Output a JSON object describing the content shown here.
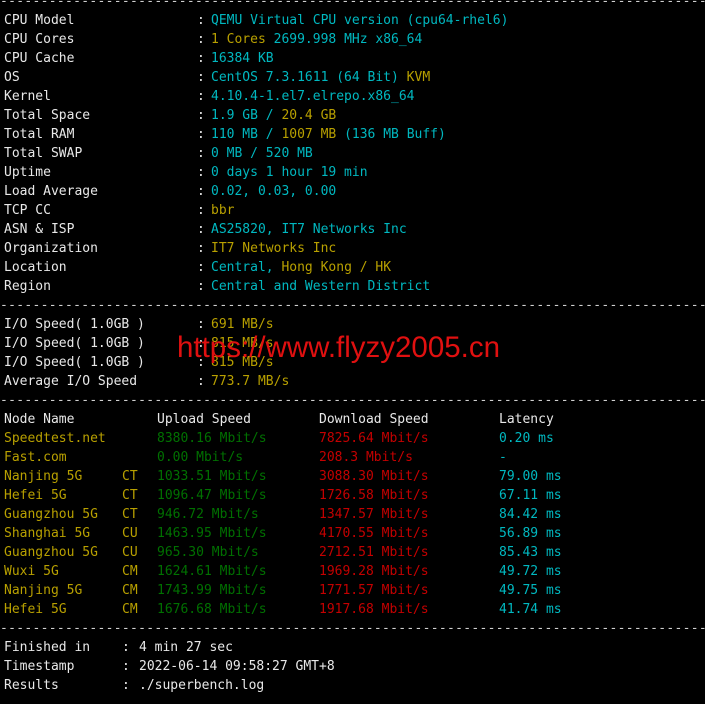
{
  "colors": {
    "white": "#e8e8e8",
    "cyan": "#00b8c0",
    "yellow": "#b8a000",
    "green": "#007000",
    "red": "#c40000",
    "watermark": "#e01010"
  },
  "separator": "------------------------------------------------------------------------------------------",
  "system_info": [
    {
      "label": "CPU Model",
      "value": [
        {
          "t": "QEMU Virtual CPU version (cpu64-rhel6)",
          "c": "cyan"
        }
      ]
    },
    {
      "label": "CPU Cores",
      "value": [
        {
          "t": "1 Cores ",
          "c": "yellow"
        },
        {
          "t": "2699.998 MHz x86_64",
          "c": "cyan"
        }
      ]
    },
    {
      "label": "CPU Cache",
      "value": [
        {
          "t": "16384 KB",
          "c": "cyan"
        }
      ]
    },
    {
      "label": "OS",
      "value": [
        {
          "t": "CentOS 7.3.1611 (64 Bit) ",
          "c": "cyan"
        },
        {
          "t": "KVM",
          "c": "yellow"
        }
      ]
    },
    {
      "label": "Kernel",
      "value": [
        {
          "t": "4.10.4-1.el7.elrepo.x86_64",
          "c": "cyan"
        }
      ]
    },
    {
      "label": "Total Space",
      "value": [
        {
          "t": "1.9 GB / ",
          "c": "cyan"
        },
        {
          "t": "20.4 GB",
          "c": "yellow"
        }
      ]
    },
    {
      "label": "Total RAM",
      "value": [
        {
          "t": "110 MB / ",
          "c": "cyan"
        },
        {
          "t": "1007 MB",
          "c": "yellow"
        },
        {
          "t": " (136 MB Buff)",
          "c": "cyan"
        }
      ]
    },
    {
      "label": "Total SWAP",
      "value": [
        {
          "t": "0 MB / 520 MB",
          "c": "cyan"
        }
      ]
    },
    {
      "label": "Uptime",
      "value": [
        {
          "t": "0 days 1 hour 19 min",
          "c": "cyan"
        }
      ]
    },
    {
      "label": "Load Average",
      "value": [
        {
          "t": "0.02, 0.03, 0.00",
          "c": "cyan"
        }
      ]
    },
    {
      "label": "TCP CC",
      "value": [
        {
          "t": "bbr",
          "c": "yellow"
        }
      ]
    },
    {
      "label": "ASN & ISP",
      "value": [
        {
          "t": "AS25820, IT7 Networks Inc",
          "c": "cyan"
        }
      ]
    },
    {
      "label": "Organization",
      "value": [
        {
          "t": "IT7 Networks Inc",
          "c": "yellow"
        }
      ]
    },
    {
      "label": "Location",
      "value": [
        {
          "t": "Central, ",
          "c": "cyan"
        },
        {
          "t": "Hong Kong / HK",
          "c": "yellow"
        }
      ]
    },
    {
      "label": "Region",
      "value": [
        {
          "t": "Central and Western District",
          "c": "cyan"
        }
      ]
    }
  ],
  "io": [
    {
      "label": "I/O Speed( 1.0GB )",
      "value": [
        {
          "t": "691 MB/s",
          "c": "yellow"
        }
      ]
    },
    {
      "label": "I/O Speed( 1.0GB )",
      "value": [
        {
          "t": "815 MB/s",
          "c": "yellow"
        }
      ]
    },
    {
      "label": "I/O Speed( 1.0GB )",
      "value": [
        {
          "t": "815 MB/s",
          "c": "yellow"
        }
      ]
    },
    {
      "label": "Average I/O Speed",
      "value": [
        {
          "t": "773.7 MB/s",
          "c": "yellow"
        }
      ]
    }
  ],
  "speedtest": {
    "headers": [
      "Node Name",
      "Upload Speed",
      "Download Speed",
      "Latency"
    ],
    "rows": [
      {
        "node": "Speedtest.net",
        "isp": "",
        "up": "8380.16 Mbit/s",
        "down": "7825.64 Mbit/s",
        "lat": "0.20 ms"
      },
      {
        "node": "Fast.com",
        "isp": "",
        "up": "0.00 Mbit/s",
        "down": "208.3 Mbit/s",
        "lat": "-"
      },
      {
        "node": "Nanjing 5G",
        "isp": "CT",
        "up": "1033.51 Mbit/s",
        "down": "3088.30 Mbit/s",
        "lat": "79.00 ms"
      },
      {
        "node": "Hefei 5G",
        "isp": "CT",
        "up": "1096.47 Mbit/s",
        "down": "1726.58 Mbit/s",
        "lat": "67.11 ms"
      },
      {
        "node": "Guangzhou 5G",
        "isp": "CT",
        "up": "946.72 Mbit/s",
        "down": "1347.57 Mbit/s",
        "lat": "84.42 ms"
      },
      {
        "node": "Shanghai 5G",
        "isp": "CU",
        "up": "1463.95 Mbit/s",
        "down": "4170.55 Mbit/s",
        "lat": "56.89 ms"
      },
      {
        "node": "Guangzhou 5G",
        "isp": "CU",
        "up": "965.30 Mbit/s",
        "down": "2712.51 Mbit/s",
        "lat": "85.43 ms"
      },
      {
        "node": "Wuxi 5G",
        "isp": "CM",
        "up": "1624.61 Mbit/s",
        "down": "1969.28 Mbit/s",
        "lat": "49.72 ms"
      },
      {
        "node": "Nanjing 5G",
        "isp": "CM",
        "up": "1743.99 Mbit/s",
        "down": "1771.57 Mbit/s",
        "lat": "49.75 ms"
      },
      {
        "node": "Hefei 5G",
        "isp": "CM",
        "up": "1676.68 Mbit/s",
        "down": "1917.68 Mbit/s",
        "lat": "41.74 ms"
      }
    ]
  },
  "summary": [
    {
      "label": "Finished in",
      "value": "4 min 27 sec"
    },
    {
      "label": "Timestamp",
      "value": "2022-06-14 09:58:27 GMT+8"
    },
    {
      "label": "Results",
      "value": "./superbench.log"
    }
  ],
  "watermark": "https://www.flyzy2005.cn"
}
